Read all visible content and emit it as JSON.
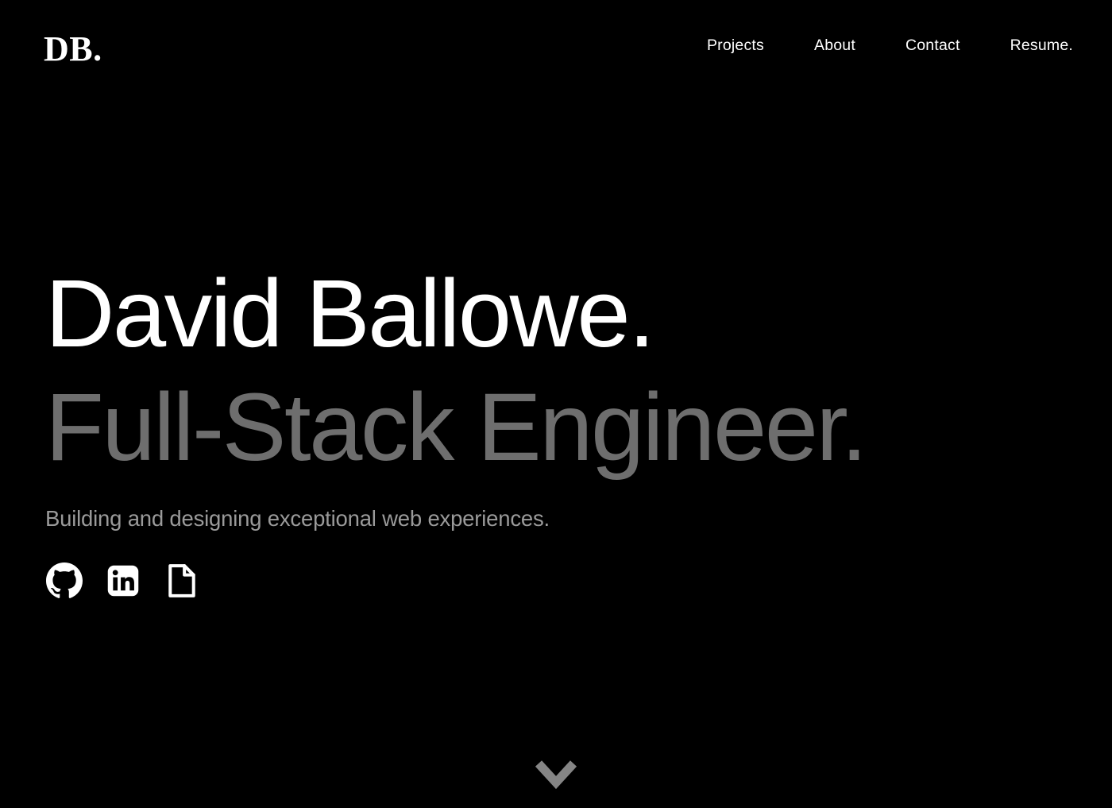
{
  "theme": {
    "background": "#000000",
    "text_primary": "#ffffff",
    "text_muted": "#6e6e6e",
    "text_secondary": "#9a9a9a"
  },
  "header": {
    "logo": "DB.",
    "nav": [
      {
        "label": "Projects"
      },
      {
        "label": "About"
      },
      {
        "label": "Contact"
      },
      {
        "label": "Resume."
      }
    ]
  },
  "hero": {
    "name": "David Ballowe.",
    "role": "Full-Stack Engineer.",
    "tagline": "Building and designing exceptional web experiences.",
    "social": [
      {
        "icon": "github-icon",
        "label": "GitHub"
      },
      {
        "icon": "linkedin-icon",
        "label": "LinkedIn"
      },
      {
        "icon": "resume-document-icon",
        "label": "Resume"
      }
    ]
  },
  "scroll_indicator": {
    "icon": "chevron-down-icon",
    "label": "Scroll down"
  }
}
